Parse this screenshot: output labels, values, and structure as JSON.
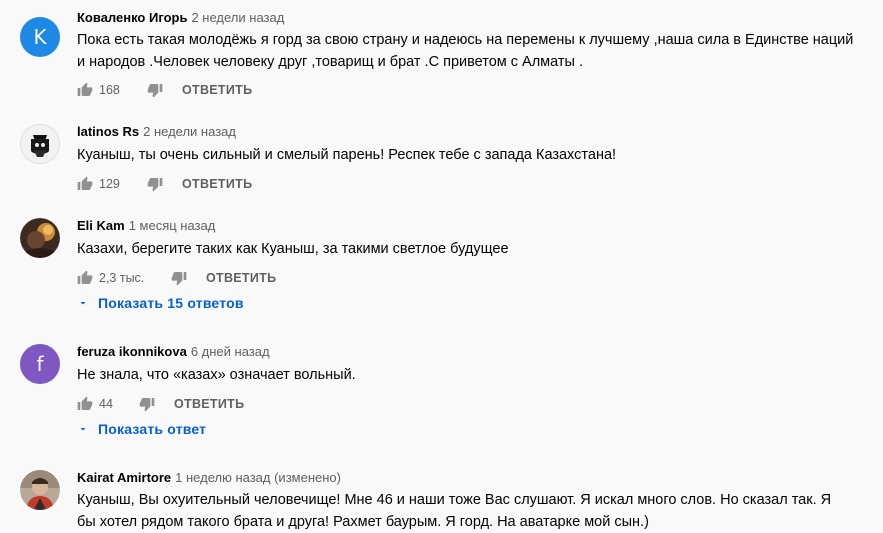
{
  "comments": [
    {
      "author": "Коваленко Игорь",
      "time": "2 недели назад",
      "text": "Пока есть такая молодёжь я горд за свою страну и надеюсь на перемены к лучшему ,наша сила в Единстве наций и народов .Человек человеку друг ,товарищ и брат .С приветом с Алматы .",
      "likes": "168",
      "reply_label": "ОТВЕТИТЬ",
      "avatar_letter": "K",
      "avatar_color": "#1e88e5"
    },
    {
      "author": "latinos Rs",
      "time": "2 недели назад",
      "text": "Куаныш, ты очень сильный и смелый парень! Респек тебе с запада Казахстана!",
      "likes": "129",
      "reply_label": "ОТВЕТИТЬ",
      "avatar_letter": "",
      "avatar_color": "#ffffff"
    },
    {
      "author": "Eli Kam",
      "time": "1 месяц назад",
      "text": "Казахи, берегите таких как Куаныш, за такими светлое будущее",
      "likes": "2,3 тыс.",
      "reply_label": "ОТВЕТИТЬ",
      "avatar_letter": "",
      "avatar_color": "#7a4a2a",
      "replies_label": "Показать 15 ответов"
    },
    {
      "author": "feruza ikonnikova",
      "time": "6 дней назад",
      "text": "Не знала, что «казах» означает вольный.",
      "likes": "44",
      "reply_label": "ОТВЕТИТЬ",
      "avatar_letter": "f",
      "avatar_color": "#7e57c2",
      "replies_label": "Показать ответ"
    },
    {
      "author": "Kairat Amirtore",
      "time": "1 неделю назад (изменено)",
      "text": "Куаныш, Вы охуительный человечище! Мне 46 и наши тоже Вас слушают. Я искал много слов. Но сказал так. Я бы хотел рядом такого брата и друга! Рахмет баурым. Я горд. На аватарке мой сын.)",
      "avatar_letter": "",
      "avatar_color": "#8a6d5a"
    }
  ],
  "icons": {
    "like": "thumb-up-icon",
    "dislike": "thumb-down-icon",
    "expand": "chevron-down-icon"
  }
}
